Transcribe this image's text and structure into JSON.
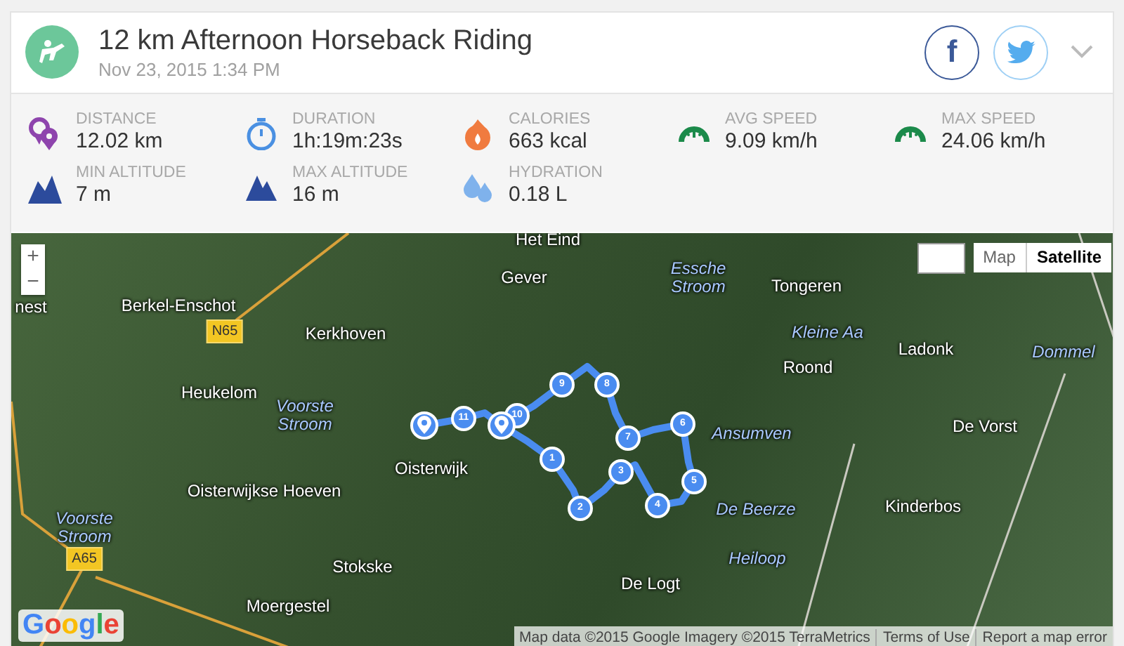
{
  "activity": {
    "title": "12 km Afternoon Horseback Riding",
    "date": "Nov 23, 2015 1:34 PM"
  },
  "share_buttons": [
    {
      "kind": "facebook",
      "label": "f"
    },
    {
      "kind": "twitter"
    }
  ],
  "stats": [
    {
      "kind": "distance",
      "label": "DISTANCE",
      "value": "12.02 km"
    },
    {
      "kind": "duration",
      "label": "DURATION",
      "value": "1h:19m:23s"
    },
    {
      "kind": "calories",
      "label": "CALORIES",
      "value": "663 kcal"
    },
    {
      "kind": "speed",
      "label": "AVG SPEED",
      "value": "9.09 km/h"
    },
    {
      "kind": "speed",
      "label": "MAX SPEED",
      "value": "24.06 km/h"
    },
    {
      "kind": "min_altitude",
      "label": "MIN ALTITUDE",
      "value": "7 m"
    },
    {
      "kind": "max_altitude",
      "label": "MAX ALTITUDE",
      "value": "16 m"
    },
    {
      "kind": "hydration",
      "label": "HYDRATION",
      "value": "0.18 L"
    }
  ],
  "map": {
    "zoom_controls": [
      "+",
      "−"
    ],
    "map_types": [
      {
        "label": "Map",
        "selected": false
      },
      {
        "label": "Satellite",
        "selected": true
      }
    ],
    "labels": [
      {
        "kind": "place",
        "text": "Het Eind"
      },
      {
        "kind": "place",
        "text": "Gever"
      },
      {
        "kind": "water",
        "text": "Essche Stroom"
      },
      {
        "kind": "place",
        "text": "Tongeren"
      },
      {
        "kind": "place",
        "text": "nest"
      },
      {
        "kind": "place",
        "text": "Berkel-Enschot"
      },
      {
        "kind": "road",
        "text": "N65"
      },
      {
        "kind": "place",
        "text": "Kerkhoven"
      },
      {
        "kind": "water",
        "text": "Kleine Aa"
      },
      {
        "kind": "place",
        "text": "Ladonk"
      },
      {
        "kind": "water",
        "text": "Dommel"
      },
      {
        "kind": "place",
        "text": "Roond"
      },
      {
        "kind": "place",
        "text": "Heukelom"
      },
      {
        "kind": "water",
        "text": "Voorste Stroom"
      },
      {
        "kind": "water",
        "text": "Ansumven"
      },
      {
        "kind": "place",
        "text": "De Vorst"
      },
      {
        "kind": "place",
        "text": "Oisterwijk"
      },
      {
        "kind": "place",
        "text": "Oisterwijkse Hoeven"
      },
      {
        "kind": "place",
        "text": "Kinderbos"
      },
      {
        "kind": "water",
        "text": "De Beerze"
      },
      {
        "kind": "water",
        "text": "Heiloop"
      },
      {
        "kind": "water",
        "text": "Voorste Stroom"
      },
      {
        "kind": "road",
        "text": "A65"
      },
      {
        "kind": "place",
        "text": "Stokske"
      },
      {
        "kind": "place",
        "text": "De Logt"
      },
      {
        "kind": "place",
        "text": "Moergestel"
      }
    ],
    "route_markers": [
      {
        "kind": "number",
        "label": "1"
      },
      {
        "kind": "number",
        "label": "2"
      },
      {
        "kind": "number",
        "label": "3"
      },
      {
        "kind": "number",
        "label": "4"
      },
      {
        "kind": "number",
        "label": "5"
      },
      {
        "kind": "number",
        "label": "6"
      },
      {
        "kind": "number",
        "label": "7"
      },
      {
        "kind": "number",
        "label": "8"
      },
      {
        "kind": "number",
        "label": "9"
      },
      {
        "kind": "number",
        "label": "10"
      },
      {
        "kind": "number",
        "label": "11"
      },
      {
        "kind": "pin"
      },
      {
        "kind": "pin"
      }
    ],
    "logo": "Google",
    "attribution": [
      "Map data ©2015 Google Imagery ©2015 TerraMetrics",
      "Terms of Use",
      "Report a map error"
    ]
  }
}
